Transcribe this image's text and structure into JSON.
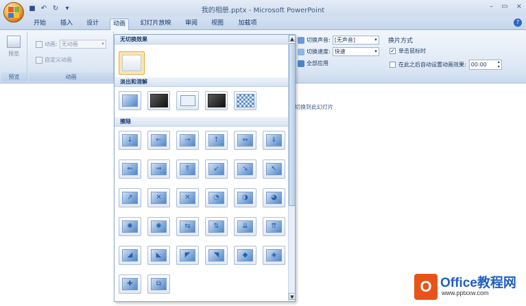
{
  "window": {
    "title": "我的相册.pptx - Microsoft PowerPoint",
    "min_glyph": "–",
    "max_glyph": "▭",
    "close_glyph": "×"
  },
  "qat": {
    "save_glyph": "■",
    "undo_glyph": "↶",
    "redo_glyph": "↻",
    "more_glyph": "▾"
  },
  "tabs": [
    "开始",
    "插入",
    "设计",
    "动画",
    "幻灯片放映",
    "审阅",
    "视图",
    "加载项"
  ],
  "active_tab": "动画",
  "help_glyph": "?",
  "ribbon": {
    "preview_group": {
      "button_label": "预览",
      "group_label": "预览"
    },
    "animation_group": {
      "animate_label": "动画:",
      "animate_value": "无动画",
      "custom_label": "自定义动画",
      "group_label": "动画"
    },
    "transition_group": {
      "sound_label": "切换声音:",
      "sound_value": "[无声音]",
      "speed_label": "切换速度:",
      "speed_value": "快速",
      "apply_all_label": "全部应用",
      "group_label": "切换到此幻灯片"
    },
    "advance_group": {
      "title": "换片方式",
      "on_click_label": "单击鼠标时",
      "on_click_checked": true,
      "auto_label": "在此之后自动设置动画效果:",
      "auto_checked": false,
      "auto_time": "00:00"
    }
  },
  "gallery": {
    "sections": [
      {
        "label": "无切换效果"
      },
      {
        "label": "淡出和溶解"
      },
      {
        "label": "擦除"
      }
    ],
    "wipe_arrows": [
      "↓",
      "←",
      "→",
      "↑",
      "⇔",
      "⇓",
      "⇐",
      "⇒",
      "⇑",
      "↙",
      "↘",
      "↖",
      "↗",
      "✕",
      "✕",
      "◔",
      "◑",
      "◕",
      "✺",
      "✺",
      "⇆",
      "⇅",
      "⇊",
      "⇈",
      "◢",
      "◣",
      "◤",
      "◥",
      "◆",
      "◈",
      "✚",
      "⧉"
    ]
  },
  "watermark": {
    "logo_glyph": "O",
    "name": "Office教程网",
    "url": "www.pptxxw.com"
  }
}
